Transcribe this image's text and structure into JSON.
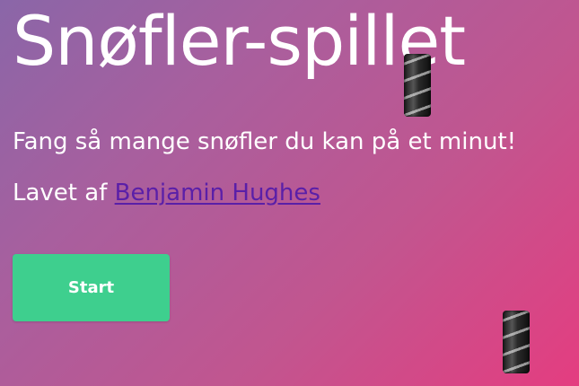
{
  "page": {
    "title": "Snøfler-spillet",
    "subtitle": "Fang så mange snøfler du kan på et minut!",
    "author_prefix": "Lavet af ",
    "author_name": "Benjamin Hughes",
    "start_label": "Start"
  },
  "colors": {
    "gradient_start": "#8a66a8",
    "gradient_end": "#e43d80",
    "start_button": "#3ecf8e",
    "link": "#5a1fa8"
  },
  "objects": {
    "falling_item_icon": "snofler-icon"
  }
}
